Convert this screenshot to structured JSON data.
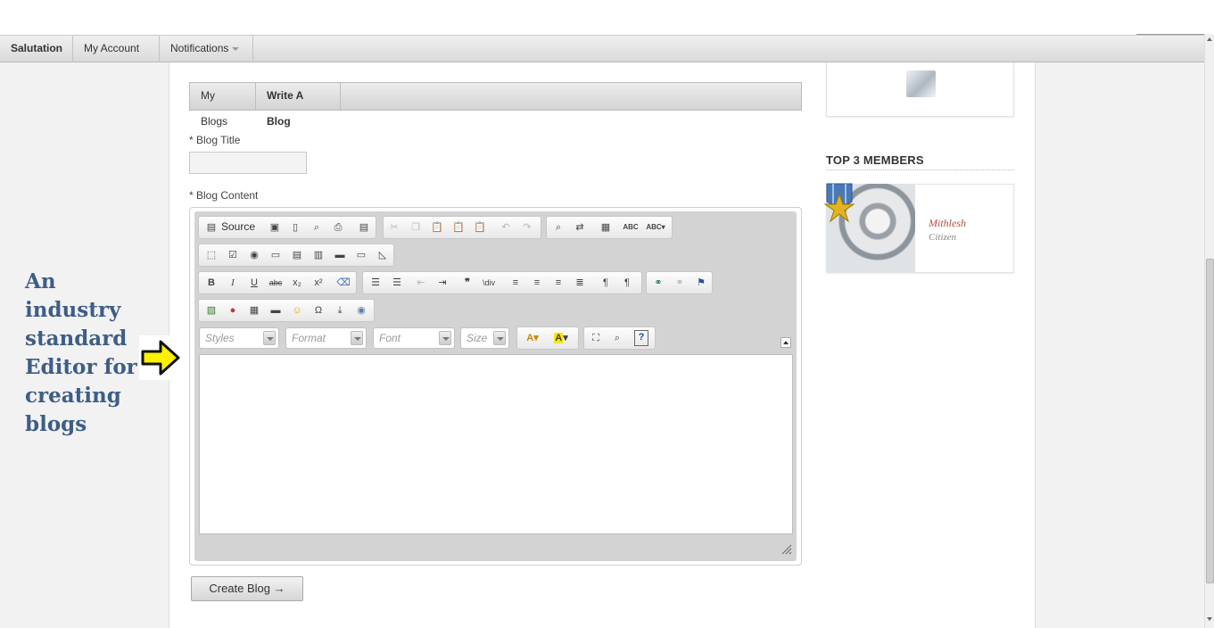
{
  "topnav": {
    "items": [
      {
        "label": "Salutation",
        "has_caret": false
      },
      {
        "label": "My Account",
        "has_caret": true
      },
      {
        "label": "Notifications",
        "has_caret": true
      }
    ]
  },
  "subtabs": {
    "my_blogs": "My Blogs",
    "write_blog": "Write A Blog",
    "active": "Write A Blog"
  },
  "form": {
    "title_label": "* Blog Title",
    "title_value": "",
    "content_label": "* Blog Content",
    "submit_label": "Create Blog →"
  },
  "editor": {
    "source_label": "Source",
    "styles_placeholder": "Styles",
    "format_placeholder": "Format",
    "font_placeholder": "Font",
    "size_placeholder": "Size"
  },
  "sidebar": {
    "members_title": "TOP 3 MEMBERS",
    "member": {
      "name": "Mithlesh",
      "role": "Citizen"
    }
  },
  "annotation": {
    "text": "An industry standard Editor for creating blogs"
  },
  "colors": {
    "annotation": "#3e5d87",
    "member_name": "#b04a3a",
    "arrow_fill": "#fff200"
  }
}
